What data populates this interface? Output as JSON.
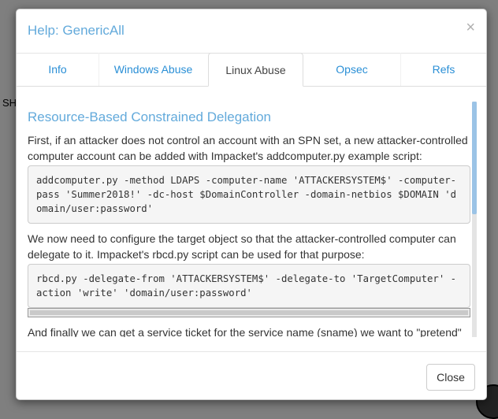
{
  "background": {
    "text": "SH"
  },
  "modal": {
    "title": "Help: GenericAll",
    "close_glyph": "×",
    "tabs": [
      {
        "label": "Info"
      },
      {
        "label": "Windows Abuse"
      },
      {
        "label": "Linux Abuse",
        "active": true
      },
      {
        "label": "Opsec"
      },
      {
        "label": "Refs"
      }
    ],
    "content": {
      "heading": "Resource-Based Constrained Delegation",
      "p1": "First, if an attacker does not control an account with an SPN set, a new attacker-controlled computer account can be added with Impacket's addcomputer.py example script:",
      "code1": "addcomputer.py -method LDAPS -computer-name 'ATTACKERSYSTEM$' -computer-pass 'Summer2018!' -dc-host $DomainController -domain-netbios $DOMAIN 'domain/user:password'",
      "p2": "We now need to configure the target object so that the attacker-controlled computer can delegate to it. Impacket's rbcd.py script can be used for that purpose:",
      "code2": "rbcd.py -delegate-from 'ATTACKERSYSTEM$' -delegate-to 'TargetComputer' -action 'write' 'domain/user:password'",
      "p3": "And finally we can get a service ticket for the service name (sname) we want to \"pretend\""
    },
    "footer": {
      "close_label": "Close"
    }
  },
  "colors": {
    "accent": "#63aadb",
    "link": "#2a8fd6",
    "backdrop": "#7f7f7f"
  }
}
